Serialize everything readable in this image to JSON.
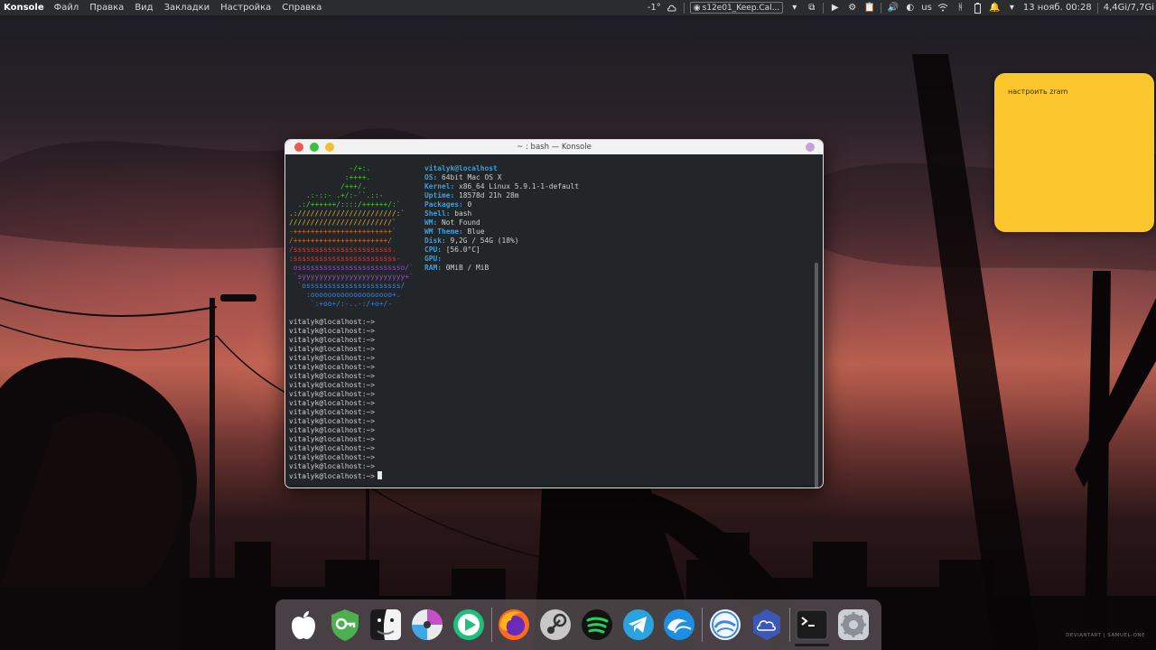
{
  "top_panel": {
    "app_name": "Konsole",
    "menu": [
      "Файл",
      "Правка",
      "Вид",
      "Закладки",
      "Настройка",
      "Справка"
    ],
    "weather_temp": "-1°",
    "task_label": "s12e01_Keep.Cal...",
    "keyboard_layout": "us",
    "clock": "13 нояб. 00:28",
    "memory": "4,4Gi/7,7Gi"
  },
  "note": {
    "text": "настроить zram"
  },
  "konsole": {
    "title": "~ : bash — Konsole",
    "logo_lines": [
      "              -/+:.",
      "             :++++.",
      "            /+++/.",
      "    .:-::- .+/:-``.::-",
      "  .:/++++++/::::/++++++/:`",
      ".:///////////////////////:`",
      "////////////////////////`",
      "-+++++++++++++++++++++++`",
      "/++++++++++++++++++++++/",
      "/sssssssssssssssssssssss.",
      ":ssssssssssssssssssssssss-",
      " osssssssssssssssssssssssso/`",
      " `syyyyyyyyyyyyyyyyyyyyyyyy+`",
      "  `ossssssssssssssssssssss/",
      "    :ooooooooooooooooooo+.",
      "     `:+oo+/:-..-:/+o+/-"
    ],
    "logo_colors": [
      "#51c23d",
      "#51c23d",
      "#51c23d",
      "#51c23d",
      "#51c23d",
      "#e2ac2e",
      "#e2ac2e",
      "#d86b26",
      "#d86b26",
      "#cf3b3b",
      "#cf3b3b",
      "#8e4fbe",
      "#8e4fbe",
      "#3c83d8",
      "#3c83d8",
      "#3c83d8"
    ],
    "user_host": "vitalyk@localhost",
    "info": [
      {
        "key": "OS:",
        "value": " 64bit Mac OS X"
      },
      {
        "key": "Kernel:",
        "value": " x86_64 Linux 5.9.1-1-default"
      },
      {
        "key": "Uptime:",
        "value": " 18578d 21h 28m"
      },
      {
        "key": "Packages:",
        "value": " 0"
      },
      {
        "key": "Shell:",
        "value": " bash"
      },
      {
        "key": "WM:",
        "value": " Not Found"
      },
      {
        "key": "WM Theme:",
        "value": " Blue"
      },
      {
        "key": "Disk:",
        "value": " 9,2G / 54G (18%)"
      },
      {
        "key": "CPU:",
        "value": " [56.0°C]"
      },
      {
        "key": "GPU:",
        "value": ""
      },
      {
        "key": "RAM:",
        "value": " 0MiB / MiB"
      }
    ],
    "prompt": "vitalyk@localhost:~>",
    "prompt_count": 18
  },
  "dock": {
    "items": [
      {
        "name": "apple-menu-icon",
        "color": "#ffffff"
      },
      {
        "name": "kgpg-key-icon",
        "color": "#4caf50"
      },
      {
        "name": "finder-icon",
        "color": "#1a1a1a"
      },
      {
        "name": "disk-burner-icon",
        "color": "#c44fc9"
      },
      {
        "name": "media-player-icon",
        "color": "#1fbf7e"
      },
      {
        "name": "firefox-icon",
        "color": "#ff6a1e"
      },
      {
        "name": "steam-icon",
        "color": "#c7c7c7"
      },
      {
        "name": "spotify-icon",
        "color": "#1ed760"
      },
      {
        "name": "telegram-icon",
        "color": "#2aa3e0"
      },
      {
        "name": "browser-wave-icon",
        "color": "#1c8ee3"
      },
      {
        "name": "browser-wave-alt-icon",
        "color": "#3d8be0"
      },
      {
        "name": "cloud-icon",
        "color": "#3b58b8"
      },
      {
        "name": "terminal-icon",
        "color": "#1b1b1b"
      },
      {
        "name": "system-settings-icon",
        "color": "#8a8f96"
      }
    ]
  },
  "watermark": "DEVIANTART | SAMUEL-ONE"
}
